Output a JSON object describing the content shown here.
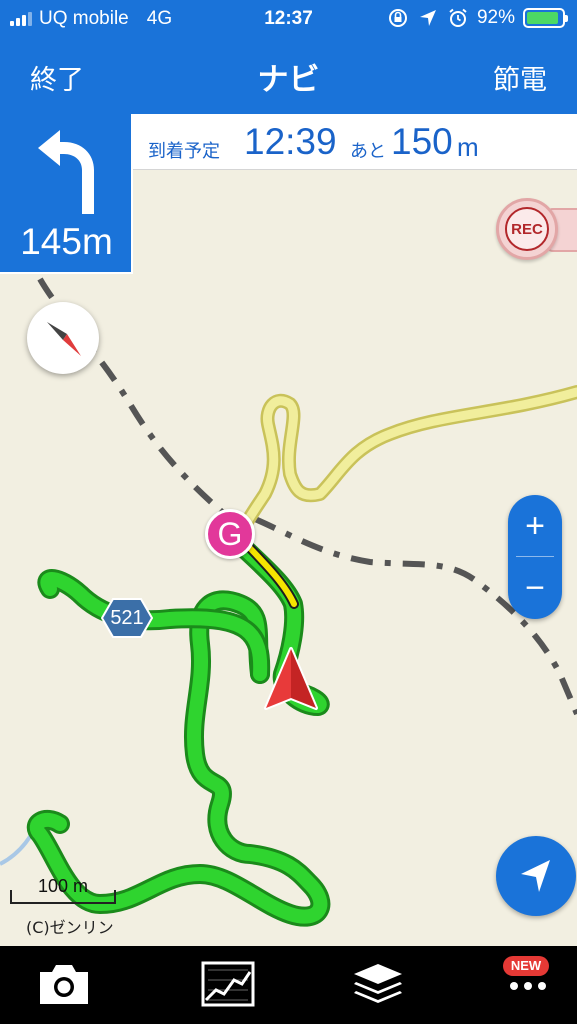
{
  "status_bar": {
    "carrier": "UQ mobile",
    "network": "4G",
    "time": "12:37",
    "battery": "92%",
    "battery_level": 0.92
  },
  "nav": {
    "end_label": "終了",
    "title": "ナビ",
    "power_save_label": "節電"
  },
  "guidance": {
    "turn_icon": "turn-left-arrow-icon",
    "turn_distance": "145m",
    "eta_label": "到着予定",
    "eta_time": "12:39",
    "remaining_label": "あと",
    "remaining_value": "150",
    "remaining_unit": "m"
  },
  "map": {
    "rec_label": "REC",
    "goal_label": "G",
    "road_number": "521",
    "scale_label": "100 m",
    "copyright": "(C)ゼンリン",
    "zoom_in": "+",
    "zoom_out": "−"
  },
  "toolbar": {
    "items": [
      "camera-icon",
      "chart-icon",
      "layers-icon",
      "more-icon"
    ],
    "new_badge": "NEW"
  },
  "colors": {
    "primary": "#1a73d9",
    "route": "#2fd42f",
    "guide_route": "#f5e400",
    "goal": "#e2389a",
    "map_bg": "#f2efe1"
  }
}
